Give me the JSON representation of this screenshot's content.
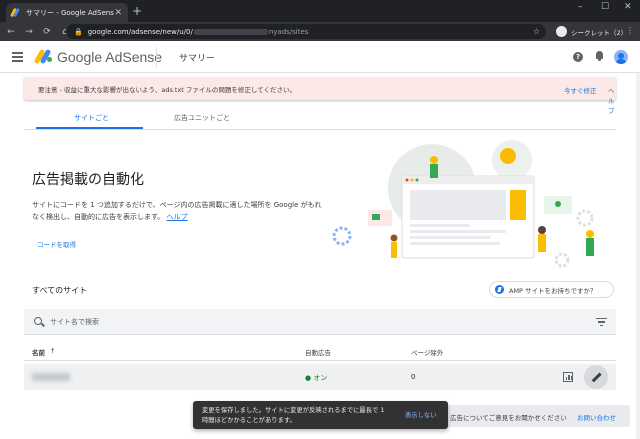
{
  "browser": {
    "tab_title": "サマリー - Google AdSense",
    "tab_close": "✕",
    "new_tab": "+",
    "window_controls": [
      "–",
      "☐",
      "✕"
    ],
    "nav": {
      "back": "←",
      "forward": "→",
      "reload": "⟳",
      "home": "⌂"
    },
    "url_prefix": "google.com/adsense/new/u/0/",
    "url_suffix": "nyads/sites",
    "profile_label": "シークレット（2）"
  },
  "header": {
    "brand": "Google AdSense",
    "page_title": "サマリー",
    "help_glyph": "?"
  },
  "alert": {
    "message": "要注意 - 収益に重大な影響が出ないよう、ads.txt ファイルの問題を修正してください。",
    "fix_label": "今すぐ修正",
    "help_label": "ヘルプ"
  },
  "tabs": [
    {
      "label": "サイトごと"
    },
    {
      "label": "広告ユニットごと"
    }
  ],
  "hero": {
    "title": "広告掲載の自動化",
    "description": "サイトにコードを 1 つ追加するだけで、ページ内の広告掲載に適した場所を Google がもれなく検出し、自動的に広告を表示します。",
    "help_link": "ヘルプ",
    "get_code_label": "コードを取得"
  },
  "sites": {
    "title": "すべてのサイト",
    "amp_label": "AMP サイトをお持ちですか？",
    "search_placeholder": "サイト名で検索",
    "columns": {
      "name": "名前",
      "sort_glyph": "↑",
      "auto_ads": "自動広告",
      "page_exclusions": "ページ除外"
    },
    "rows": [
      {
        "status": "● オン",
        "exclusions": "0"
      }
    ]
  },
  "feedback": {
    "text": "広告についてご意見をお聞かせください",
    "link": "お問い合わせ"
  },
  "toast": {
    "message": "変更を保存しました。サイトに変更が反映されるまでに最長で 1 時間ほどかかることがあります。",
    "action": "表示しない"
  },
  "colors": {
    "accent": "#1a73e8",
    "alert_bg": "#fce8e6",
    "status_on": "#188038",
    "browser_dark": "#202124"
  }
}
